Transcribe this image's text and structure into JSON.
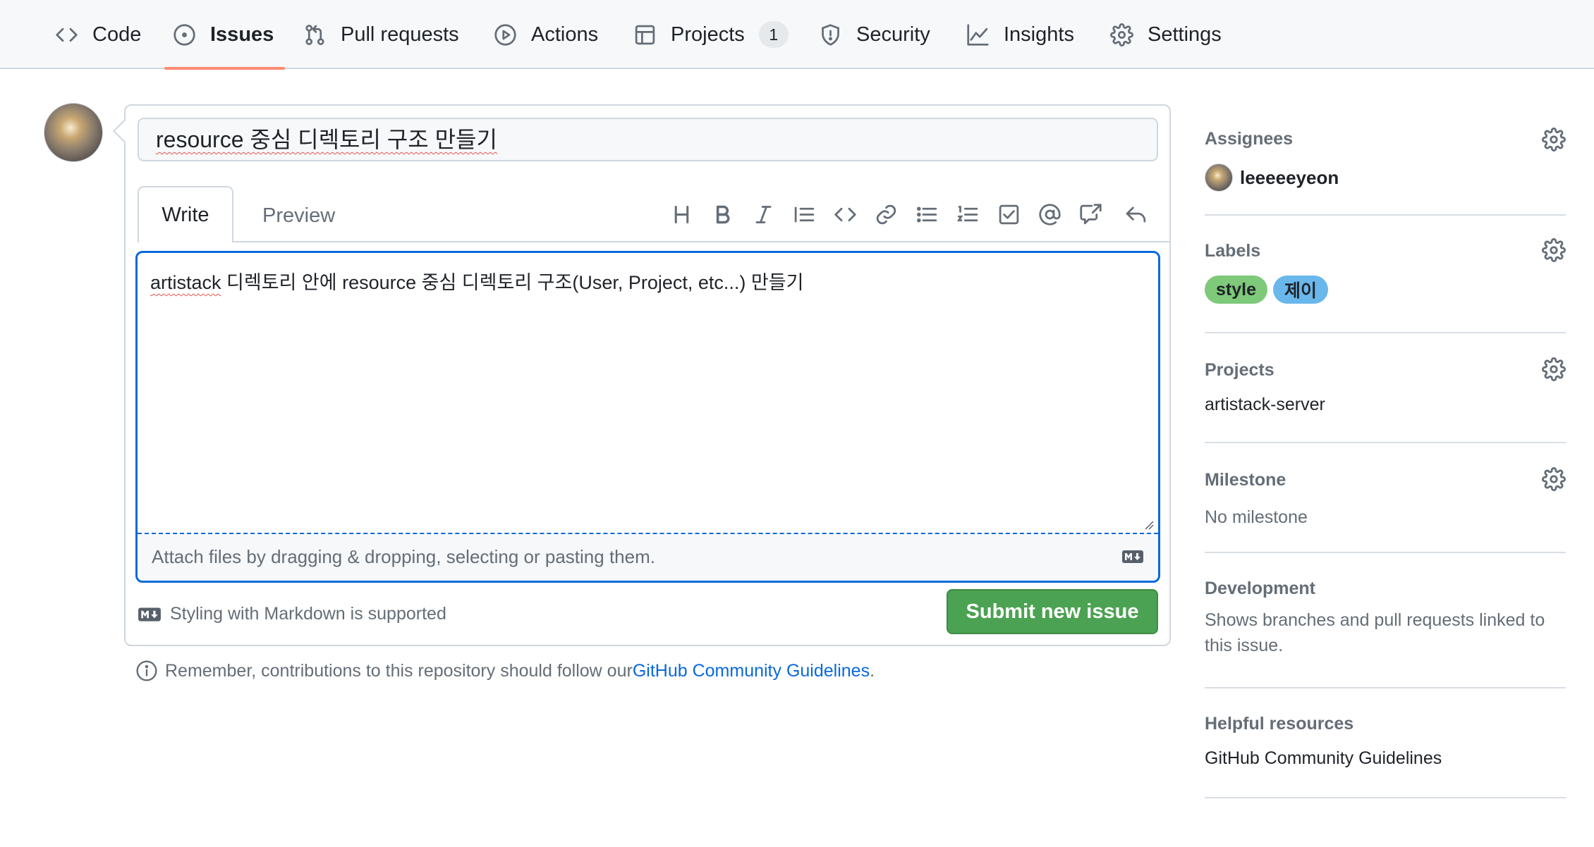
{
  "nav": {
    "tabs": [
      {
        "label": "Code",
        "icon": "code-icon"
      },
      {
        "label": "Issues",
        "icon": "issue-opened-icon",
        "active": true
      },
      {
        "label": "Pull requests",
        "icon": "git-pull-request-icon"
      },
      {
        "label": "Actions",
        "icon": "play-icon"
      },
      {
        "label": "Projects",
        "icon": "table-icon",
        "counter": "1"
      },
      {
        "label": "Security",
        "icon": "shield-icon"
      },
      {
        "label": "Insights",
        "icon": "graph-icon"
      },
      {
        "label": "Settings",
        "icon": "gear-icon"
      }
    ]
  },
  "issue_form": {
    "title_value": "resource 중심 디렉토리 구조 만들기",
    "tabs": {
      "write": "Write",
      "preview": "Preview"
    },
    "toolbar": [
      "heading-icon",
      "bold-icon",
      "italic-icon",
      "quote-icon",
      "code-icon",
      "link-icon",
      "unordered-list-icon",
      "ordered-list-icon",
      "tasklist-icon",
      "mention-icon",
      "cross-reference-icon",
      "reply-icon"
    ],
    "body_value": "artistack 디렉토리 안에 resource 중심 디렉토리 구조(User, Project, etc...) 만들기",
    "attach_text": "Attach files by dragging & dropping, selecting or pasting them.",
    "markdown_note": "Styling with Markdown is supported",
    "submit_label": "Submit new issue"
  },
  "footer_note": {
    "text": "Remember, contributions to this repository should follow our ",
    "link": "GitHub Community Guidelines",
    "suffix": "."
  },
  "sidebar": {
    "assignees": {
      "title": "Assignees",
      "user": "leeeeeyeon"
    },
    "labels": {
      "title": "Labels",
      "items": [
        {
          "name": "style",
          "color": "#7ec97a"
        },
        {
          "name": "제이",
          "color": "#6ab7ec"
        }
      ]
    },
    "projects": {
      "title": "Projects",
      "value": "artistack-server"
    },
    "milestone": {
      "title": "Milestone",
      "value": "No milestone"
    },
    "development": {
      "title": "Development",
      "value": "Shows branches and pull requests linked to this issue."
    },
    "helpful": {
      "title": "Helpful resources",
      "link": "GitHub Community Guidelines"
    }
  },
  "colors": {
    "accent": "#0969da",
    "submit": "#4ba252",
    "active_tab_underline": "#fd8c73"
  }
}
